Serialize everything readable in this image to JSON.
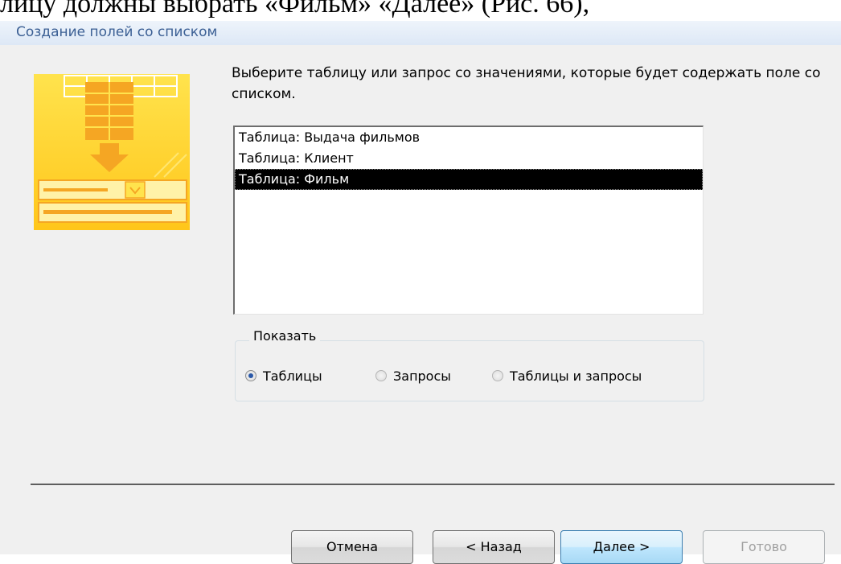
{
  "doc_caption": "лицу должны выбрать «Фильм» «Далее» (Рис. 66),",
  "window": {
    "title": "Создание полей со списком"
  },
  "instruction": "Выберите таблицу или запрос со значениями, которые будет содержать поле со списком.",
  "list": {
    "items": [
      {
        "label": "Таблица: Выдача фильмов",
        "selected": false
      },
      {
        "label": "Таблица: Клиент",
        "selected": false
      },
      {
        "label": "Таблица: Фильм",
        "selected": true
      }
    ]
  },
  "show_group": {
    "legend": "Показать",
    "options": [
      {
        "label": "Таблицы",
        "checked": true
      },
      {
        "label": "Запросы",
        "checked": false
      },
      {
        "label": "Таблицы и запросы",
        "checked": false
      }
    ]
  },
  "buttons": {
    "cancel": "Отмена",
    "back": "< Назад",
    "next": "Далее >",
    "finish": "Готово"
  },
  "colors": {
    "title_text": "#3b5f94",
    "selection_bg": "#000000",
    "illustration_orange": "#f5a623",
    "illustration_yellow": "#ffe34d"
  },
  "icons": {
    "wizard_illustration": "table-to-combobox-icon"
  }
}
